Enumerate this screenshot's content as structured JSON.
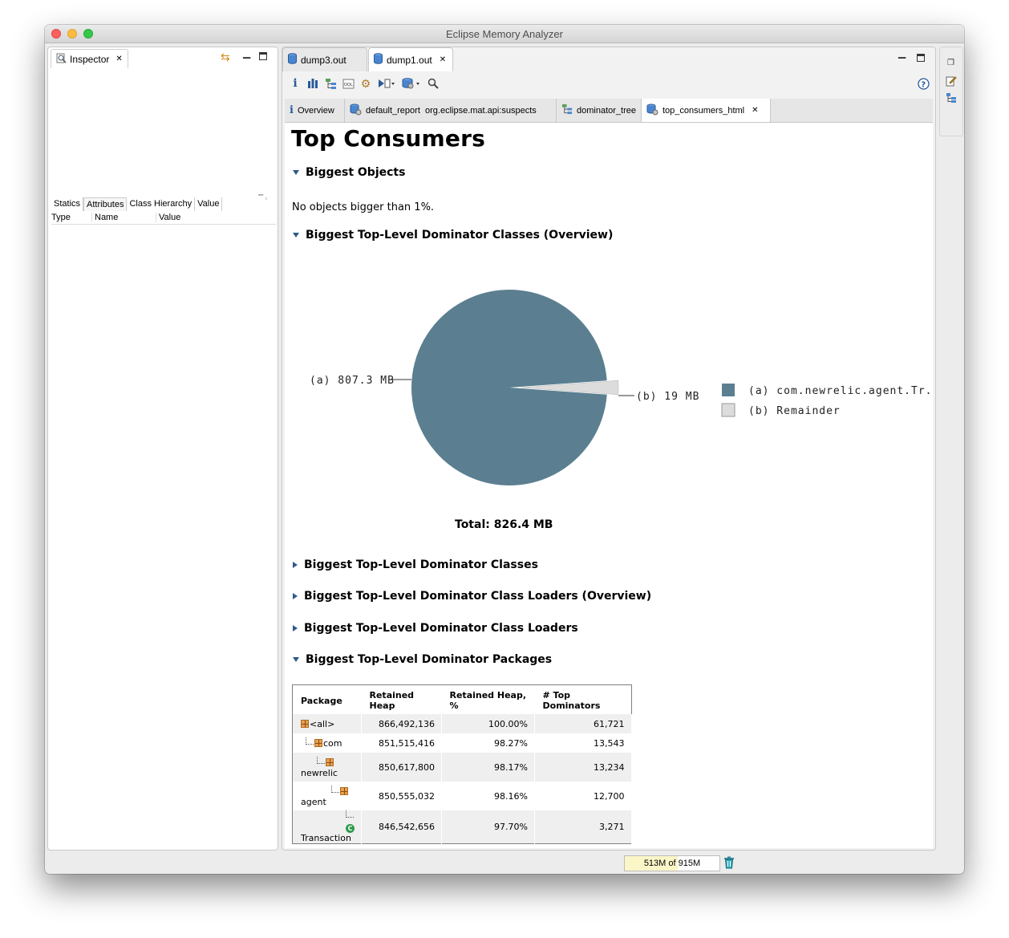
{
  "window": {
    "title": "Eclipse Memory Analyzer"
  },
  "inspector": {
    "tab_label": "Inspector",
    "close_glyph": "✕",
    "subtabs": [
      "Statics",
      "Attributes",
      "Class Hierarchy",
      "Value"
    ],
    "columns": [
      "Type",
      "Name",
      "Value"
    ]
  },
  "editor_tabs": [
    {
      "label": "dump3.out",
      "icon": "heap-dump-icon"
    },
    {
      "label": "dump1.out",
      "icon": "heap-dump-icon"
    }
  ],
  "query_tabs": [
    {
      "label": "Overview",
      "icon": "info-icon"
    },
    {
      "label": "default_report  org.eclipse.mat.api:suspects",
      "icon": "report-icon"
    },
    {
      "label": "dominator_tree",
      "icon": "dominator-tree-icon"
    },
    {
      "label": "top_consumers_html",
      "icon": "report-icon"
    }
  ],
  "report": {
    "title": "Top Consumers",
    "sections": {
      "biggest_objects": "Biggest Objects",
      "no_objects_text": "No objects bigger than 1%.",
      "dominator_classes_overview": "Biggest Top-Level Dominator Classes (Overview)",
      "dominator_classes": "Biggest Top-Level Dominator Classes",
      "class_loaders_overview": "Biggest Top-Level Dominator Class Loaders (Overview)",
      "class_loaders": "Biggest Top-Level Dominator Class Loaders",
      "packages": "Biggest Top-Level Dominator Packages"
    },
    "total_label": "Total: 826.4 MB"
  },
  "chart_data": {
    "type": "pie",
    "slices": [
      {
        "label": "(a)  807.3 MB",
        "legend": "(a)  com.newrelic.agent.Tr...",
        "value": 807.3,
        "color": "#5b7f90"
      },
      {
        "label": "(b)  19 MB",
        "legend": "(b)  Remainder",
        "value": 19,
        "color": "#dcdcdc"
      }
    ],
    "total": 826.4
  },
  "packages_table": {
    "headers": [
      "Package",
      "Retained Heap",
      "Retained Heap, %",
      "# Top Dominators"
    ],
    "rows": [
      {
        "name": "<all>",
        "icon": "package-icon",
        "depth": 0,
        "heap": "866,492,136",
        "pct": "100.00%",
        "dom": "61,721"
      },
      {
        "name": "com",
        "icon": "package-icon",
        "depth": 1,
        "heap": "851,515,416",
        "pct": "98.27%",
        "dom": "13,543"
      },
      {
        "name": "newrelic",
        "icon": "package-icon",
        "depth": 2,
        "heap": "850,617,800",
        "pct": "98.17%",
        "dom": "13,234"
      },
      {
        "name": "agent",
        "icon": "package-icon",
        "depth": 3,
        "heap": "850,555,032",
        "pct": "98.16%",
        "dom": "12,700"
      },
      {
        "name": "Transaction",
        "icon": "class-icon",
        "depth": 4,
        "heap": "846,542,656",
        "pct": "97.70%",
        "dom": "3,271"
      }
    ]
  },
  "status": {
    "heap_used": "513M",
    "heap_of": "of",
    "heap_total": "915M",
    "heap_fraction": 0.56
  }
}
